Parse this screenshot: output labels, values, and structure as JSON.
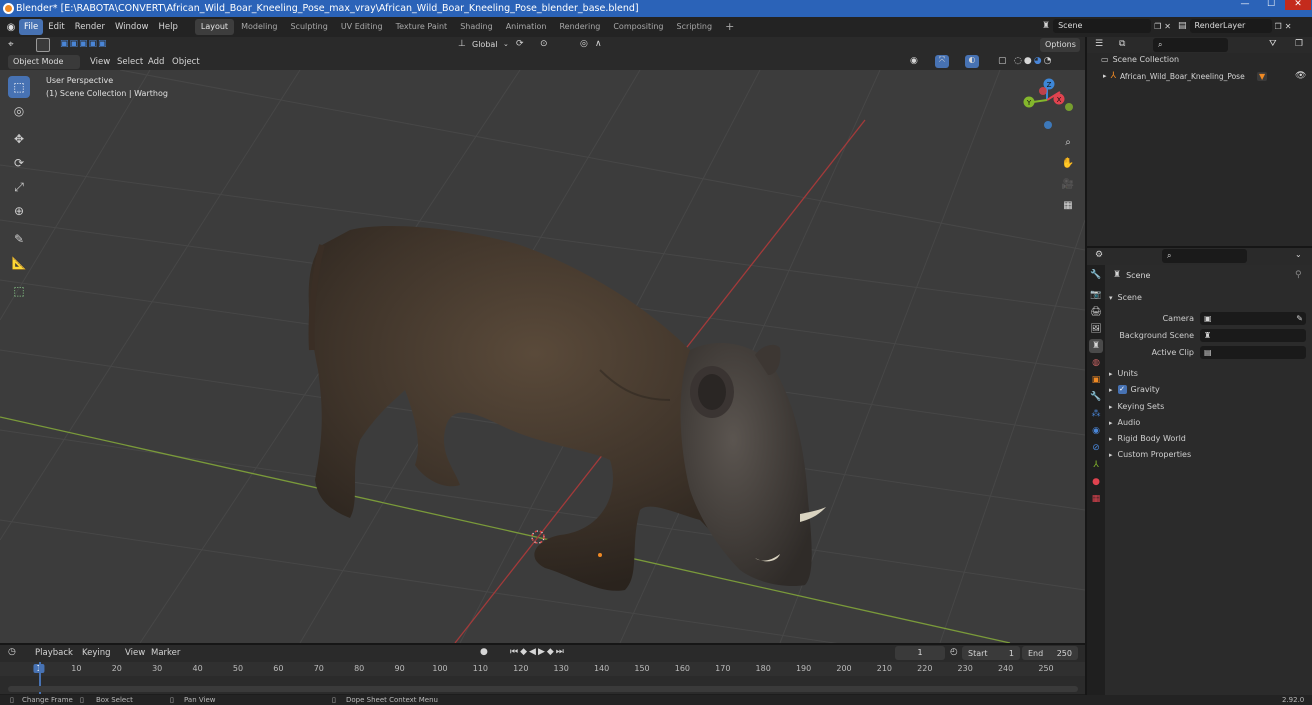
{
  "window": {
    "title": "Blender* [E:\\RABOTA\\CONVERT\\African_Wild_Boar_Kneeling_Pose_max_vray\\African_Wild_Boar_Kneeling_Pose_blender_base.blend]",
    "minimize": "—",
    "maximize": "☐",
    "close": "✕"
  },
  "menu": {
    "file": "File",
    "edit": "Edit",
    "render": "Render",
    "window": "Window",
    "help": "Help"
  },
  "workspaces": [
    "Layout",
    "Modeling",
    "Sculpting",
    "UV Editing",
    "Texture Paint",
    "Shading",
    "Animation",
    "Rendering",
    "Compositing",
    "Scripting"
  ],
  "add_workspace": "+",
  "scene_selector": {
    "value": "Scene"
  },
  "view_layer": {
    "value": "RenderLayer"
  },
  "header3d": {
    "transform_orientation": "Global",
    "options": "Options"
  },
  "header3d_row2": {
    "mode": "Object Mode",
    "view": "View",
    "select": "Select",
    "add": "Add",
    "object": "Object"
  },
  "viewport": {
    "perspective": "User Perspective",
    "collection_info": "(1) Scene Collection | Warthog"
  },
  "gizmo": {
    "x": "X",
    "y": "Y",
    "z": "Z"
  },
  "colors": {
    "accent": "#4772b3",
    "x_axis": "#e0434f",
    "y_axis": "#84b72c",
    "z_axis": "#3d87d8",
    "grid": "#474747"
  },
  "outliner": {
    "root": "Scene Collection",
    "items": [
      {
        "label": "African_Wild_Boar_Kneeling_Pose"
      }
    ]
  },
  "properties": {
    "context": "Scene",
    "section": "Scene",
    "camera_label": "Camera",
    "background_label": "Background Scene",
    "clip_label": "Active Clip",
    "panels": [
      "Units",
      "Gravity",
      "Keying Sets",
      "Audio",
      "Rigid Body World",
      "Custom Properties"
    ],
    "gravity_checked": true
  },
  "timeline": {
    "menus": {
      "playback": "Playback",
      "keying": "Keying",
      "view": "View",
      "marker": "Marker"
    },
    "current_frame": "1",
    "start_label": "Start",
    "start": "1",
    "end_label": "End",
    "end": "250",
    "ruler": [
      "1",
      "10",
      "20",
      "30",
      "40",
      "50",
      "60",
      "70",
      "80",
      "90",
      "100",
      "110",
      "120",
      "130",
      "140",
      "150",
      "160",
      "170",
      "180",
      "190",
      "200",
      "210",
      "220",
      "230",
      "240",
      "250"
    ]
  },
  "statusbar": {
    "change_frame": "Change Frame",
    "box_select": "Box Select",
    "pan_view": "Pan View",
    "context_menu": "Dope Sheet Context Menu",
    "version": "2.92.0"
  }
}
